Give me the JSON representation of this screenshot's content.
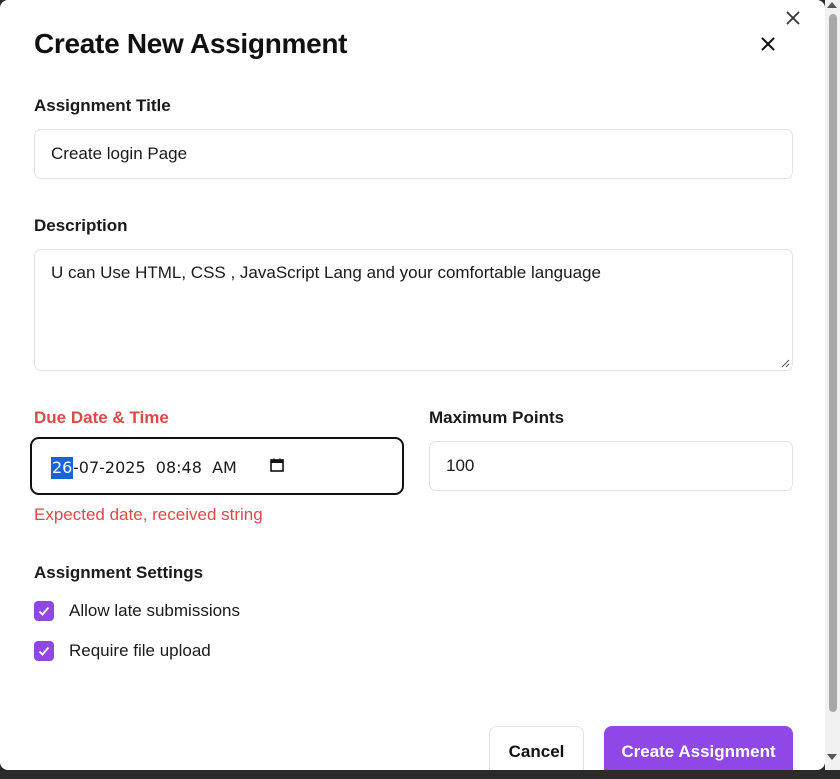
{
  "dialog": {
    "title": "Create New Assignment"
  },
  "fields": {
    "title_label": "Assignment Title",
    "title_value": "Create login Page",
    "description_label": "Description",
    "description_value": "U can Use HTML, CSS , JavaScript Lang and your comfortable language",
    "due_label": "Due Date & Time",
    "due_day": "26",
    "due_rest": "-07-2025  08:48  AM",
    "points_label": "Maximum Points",
    "points_value": "100",
    "due_error": "Expected date, received string"
  },
  "settings": {
    "heading": "Assignment Settings",
    "options": [
      {
        "label": "Allow late submissions",
        "checked": true
      },
      {
        "label": "Require file upload",
        "checked": true
      }
    ]
  },
  "actions": {
    "cancel_label": "Cancel",
    "create_label": "Create Assignment"
  },
  "colors": {
    "accent": "#8f47e6",
    "error": "#e04848",
    "selection": "#1565d8"
  },
  "icons": {
    "close": "close-icon",
    "calendar": "calendar-icon",
    "check": "checkmark-icon"
  }
}
